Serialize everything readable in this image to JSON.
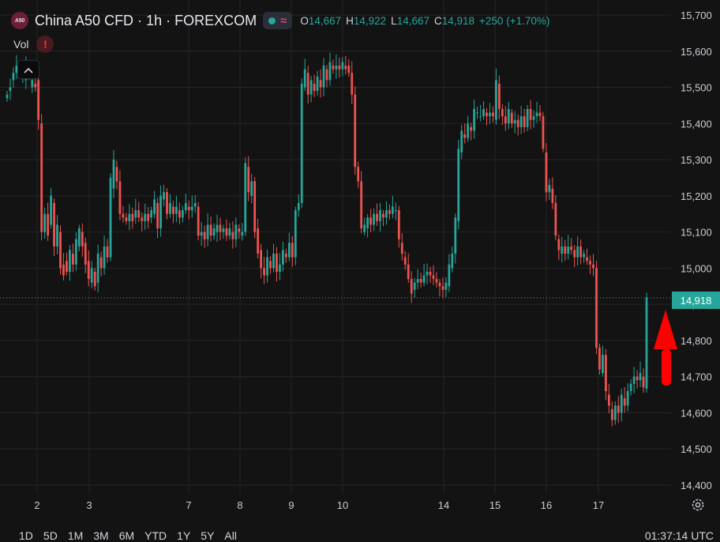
{
  "header": {
    "logo_text": "A50",
    "symbol_title": "China A50 CFD · 1h · FOREXCOM",
    "open_key": "O",
    "open": "14,667",
    "high_key": "H",
    "high": "14,922",
    "low_key": "L",
    "low": "14,667",
    "close_key": "C",
    "close": "14,918",
    "change": "+250 (+1.70%)"
  },
  "indicators": {
    "vol_label": "Vol",
    "warning_symbol": "!"
  },
  "price_tag": "14,918",
  "range_buttons": [
    "1D",
    "5D",
    "1M",
    "3M",
    "6M",
    "YTD",
    "1Y",
    "5Y",
    "All"
  ],
  "clock": "01:37:14 UTC",
  "colors": {
    "up": "#26a69a",
    "down": "#ef5350",
    "arrow": "#ff0000",
    "background": "#131313",
    "grid": "#2a2a2a"
  },
  "icons": {
    "collapse": "chevron-up-icon",
    "settings": "gear-icon",
    "annotation": "arrow-up-icon"
  },
  "chart_data": {
    "type": "candlestick",
    "interval": "1h",
    "y_ticks": [
      14400,
      14500,
      14600,
      14700,
      14800,
      14900,
      15000,
      15100,
      15200,
      15300,
      15400,
      15500,
      15600,
      15700
    ],
    "y_tick_labels": [
      "14,400",
      "14,500",
      "14,600",
      "14,700",
      "14,800",
      "14,900",
      "15,000",
      "15,100",
      "15,200",
      "15,300",
      "15,400",
      "15,500",
      "15,600",
      "15,700"
    ],
    "y_range": [
      14400,
      15700
    ],
    "x_tick_labels": [
      "2",
      "3",
      "7",
      "8",
      "9",
      "10",
      "14",
      "15",
      "16",
      "17"
    ],
    "grid": true,
    "last_price": 14918,
    "price_path": [
      [
        15470,
        15480
      ],
      [
        15490,
        15500
      ],
      [
        15520,
        15540
      ],
      [
        15540,
        15560
      ],
      [
        15550,
        15550
      ],
      [
        15540,
        15560
      ],
      [
        15520,
        15560
      ],
      [
        15540,
        15540
      ],
      [
        15500,
        15520
      ],
      [
        15510,
        15500
      ],
      [
        15520,
        15410
      ],
      [
        15400,
        15100
      ],
      [
        15100,
        15150
      ],
      [
        15150,
        15090
      ],
      [
        15120,
        15200
      ],
      [
        15180,
        15060
      ],
      [
        15060,
        15120
      ],
      [
        15100,
        15000
      ],
      [
        15010,
        14980
      ],
      [
        15020,
        14990
      ],
      [
        14990,
        15050
      ],
      [
        15040,
        15010
      ],
      [
        15010,
        15080
      ],
      [
        15060,
        15110
      ],
      [
        15100,
        15060
      ],
      [
        15070,
        15010
      ],
      [
        15020,
        14970
      ],
      [
        14960,
        15000
      ],
      [
        14990,
        14950
      ],
      [
        14960,
        15040
      ],
      [
        15030,
        15000
      ],
      [
        15000,
        15060
      ],
      [
        15060,
        15030
      ],
      [
        15030,
        15250
      ],
      [
        15220,
        15300
      ],
      [
        15280,
        15240
      ],
      [
        15240,
        15150
      ],
      [
        15150,
        15140
      ],
      [
        15140,
        15130
      ],
      [
        15130,
        15150
      ],
      [
        15150,
        15130
      ],
      [
        15140,
        15160
      ],
      [
        15160,
        15140
      ],
      [
        15140,
        15130
      ],
      [
        15130,
        15150
      ],
      [
        15150,
        15130
      ],
      [
        15140,
        15160
      ],
      [
        15150,
        15190
      ],
      [
        15180,
        15110
      ],
      [
        15110,
        15200
      ],
      [
        15190,
        15210
      ],
      [
        15210,
        15150
      ],
      [
        15150,
        15180
      ],
      [
        15170,
        15150
      ],
      [
        15150,
        15170
      ],
      [
        15160,
        15140
      ],
      [
        15140,
        15160
      ],
      [
        15160,
        15180
      ],
      [
        15170,
        15160
      ],
      [
        15160,
        15170
      ],
      [
        15170,
        15180
      ],
      [
        15170,
        15090
      ],
      [
        15090,
        15100
      ],
      [
        15100,
        15080
      ],
      [
        15080,
        15120
      ],
      [
        15120,
        15090
      ],
      [
        15090,
        15110
      ],
      [
        15100,
        15120
      ],
      [
        15120,
        15100
      ],
      [
        15100,
        15110
      ],
      [
        15110,
        15090
      ],
      [
        15090,
        15110
      ],
      [
        15100,
        15080
      ],
      [
        15080,
        15120
      ],
      [
        15110,
        15100
      ],
      [
        15090,
        15100
      ],
      [
        15100,
        15290
      ],
      [
        15280,
        15210
      ],
      [
        15200,
        15240
      ],
      [
        15240,
        15100
      ],
      [
        15110,
        15040
      ],
      [
        15050,
        15000
      ],
      [
        15000,
        14980
      ],
      [
        14980,
        15030
      ],
      [
        15020,
        15000
      ],
      [
        15000,
        15040
      ],
      [
        15040,
        14990
      ],
      [
        14990,
        15010
      ],
      [
        15010,
        15050
      ],
      [
        15040,
        15030
      ],
      [
        15030,
        15070
      ],
      [
        15070,
        15030
      ],
      [
        15030,
        15160
      ],
      [
        15160,
        15180
      ],
      [
        15180,
        15510
      ],
      [
        15500,
        15550
      ],
      [
        15540,
        15480
      ],
      [
        15480,
        15520
      ],
      [
        15510,
        15490
      ],
      [
        15490,
        15530
      ],
      [
        15520,
        15500
      ],
      [
        15500,
        15560
      ],
      [
        15550,
        15520
      ],
      [
        15520,
        15570
      ],
      [
        15560,
        15550
      ],
      [
        15550,
        15560
      ],
      [
        15560,
        15550
      ],
      [
        15550,
        15570
      ],
      [
        15560,
        15550
      ],
      [
        15560,
        15540
      ],
      [
        15540,
        15480
      ],
      [
        15480,
        15280
      ],
      [
        15280,
        15240
      ],
      [
        15240,
        15110
      ],
      [
        15100,
        15120
      ],
      [
        15110,
        15140
      ],
      [
        15140,
        15120
      ],
      [
        15120,
        15150
      ],
      [
        15150,
        15130
      ],
      [
        15130,
        15160
      ],
      [
        15150,
        15140
      ],
      [
        15140,
        15160
      ],
      [
        15160,
        15150
      ],
      [
        15150,
        15170
      ],
      [
        15160,
        15160
      ],
      [
        15160,
        15080
      ],
      [
        15070,
        15040
      ],
      [
        15030,
        15010
      ],
      [
        15010,
        14970
      ],
      [
        14970,
        14930
      ],
      [
        14940,
        14960
      ],
      [
        14960,
        14970
      ],
      [
        14970,
        14960
      ],
      [
        14960,
        14980
      ],
      [
        14980,
        14990
      ],
      [
        14990,
        14980
      ],
      [
        14980,
        14970
      ],
      [
        14970,
        14960
      ],
      [
        14960,
        14950
      ],
      [
        14950,
        14940
      ],
      [
        14940,
        14960
      ],
      [
        14950,
        15010
      ],
      [
        15000,
        15040
      ],
      [
        15040,
        15140
      ],
      [
        15130,
        15330
      ],
      [
        15320,
        15380
      ],
      [
        15370,
        15360
      ],
      [
        15360,
        15400
      ],
      [
        15390,
        15380
      ],
      [
        15380,
        15440
      ],
      [
        15430,
        15430
      ],
      [
        15420,
        15420
      ],
      [
        15420,
        15440
      ],
      [
        15430,
        15420
      ],
      [
        15420,
        15430
      ],
      [
        15430,
        15420
      ],
      [
        15410,
        15520
      ],
      [
        15510,
        15440
      ],
      [
        15440,
        15420
      ],
      [
        15420,
        15400
      ],
      [
        15400,
        15440
      ],
      [
        15430,
        15400
      ],
      [
        15400,
        15410
      ],
      [
        15410,
        15390
      ],
      [
        15390,
        15420
      ],
      [
        15420,
        15390
      ],
      [
        15390,
        15440
      ],
      [
        15440,
        15410
      ],
      [
        15410,
        15420
      ],
      [
        15420,
        15430
      ],
      [
        15430,
        15420
      ],
      [
        15420,
        15330
      ],
      [
        15320,
        15210
      ],
      [
        15210,
        15230
      ],
      [
        15220,
        15180
      ],
      [
        15180,
        15090
      ],
      [
        15080,
        15050
      ],
      [
        15040,
        15060
      ],
      [
        15060,
        15040
      ],
      [
        15040,
        15060
      ],
      [
        15060,
        15050
      ],
      [
        15050,
        15030
      ],
      [
        15030,
        15060
      ],
      [
        15060,
        15030
      ],
      [
        15030,
        15040
      ],
      [
        15030,
        15020
      ],
      [
        15020,
        15010
      ],
      [
        15010,
        15000
      ],
      [
        15000,
        14780
      ],
      [
        14780,
        14720
      ],
      [
        14710,
        14760
      ],
      [
        14760,
        14660
      ],
      [
        14650,
        14620
      ],
      [
        14610,
        14580
      ],
      [
        14580,
        14620
      ],
      [
        14620,
        14600
      ],
      [
        14600,
        14650
      ],
      [
        14640,
        14620
      ],
      [
        14620,
        14660
      ],
      [
        14660,
        14680
      ],
      [
        14680,
        14700
      ],
      [
        14700,
        14690
      ],
      [
        14690,
        14710
      ],
      [
        14700,
        14670
      ],
      [
        14667,
        14918
      ]
    ]
  }
}
